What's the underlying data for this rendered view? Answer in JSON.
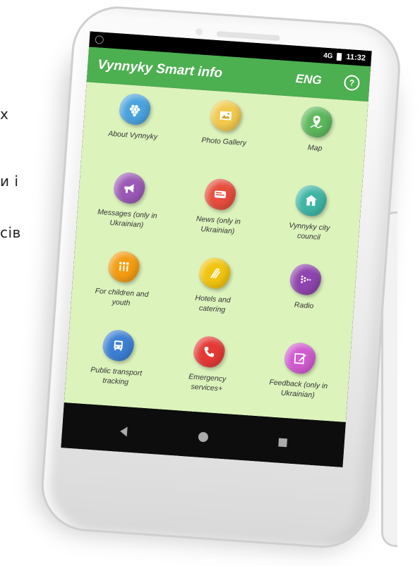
{
  "background_text": {
    "line1": "х",
    "line2": "и і",
    "line3": "сів"
  },
  "status_bar": {
    "time": "11:32",
    "signal": "4G"
  },
  "app_bar": {
    "title": "Vynnyky Smart info",
    "language": "ENG",
    "help_icon": "?"
  },
  "tiles": [
    {
      "label": "About Vynnyky",
      "icon": "grapes-icon",
      "color": "#4aa3df"
    },
    {
      "label": "Photo Gallery",
      "icon": "photo-icon",
      "color": "#f2c94c"
    },
    {
      "label": "Map",
      "icon": "map-pin-icon",
      "color": "#5cb85c"
    },
    {
      "label": "Messages (only in Ukrainian)",
      "icon": "megaphone-icon",
      "color": "#9b59b6"
    },
    {
      "label": "News (only in Ukrainian)",
      "icon": "news-icon",
      "color": "#e74c3c"
    },
    {
      "label": "Vynnyky city council",
      "icon": "building-icon",
      "color": "#3fb5a5"
    },
    {
      "label": "For children and youth",
      "icon": "children-icon",
      "color": "#f39c12"
    },
    {
      "label": "Hotels and catering",
      "icon": "fork-knife-icon",
      "color": "#f1c40f"
    },
    {
      "label": "Radio",
      "icon": "radio-icon",
      "color": "#8e44ad"
    },
    {
      "label": "Public transport tracking",
      "icon": "bus-icon",
      "color": "#3b7fd4"
    },
    {
      "label": "Emergency services+",
      "icon": "phone-icon",
      "color": "#e53935"
    },
    {
      "label": "Feedback (only in Ukrainian)",
      "icon": "edit-icon",
      "color": "#d05ad0"
    }
  ],
  "nav": {
    "back": "back-icon",
    "home": "home-icon",
    "recent": "recent-apps-icon"
  }
}
